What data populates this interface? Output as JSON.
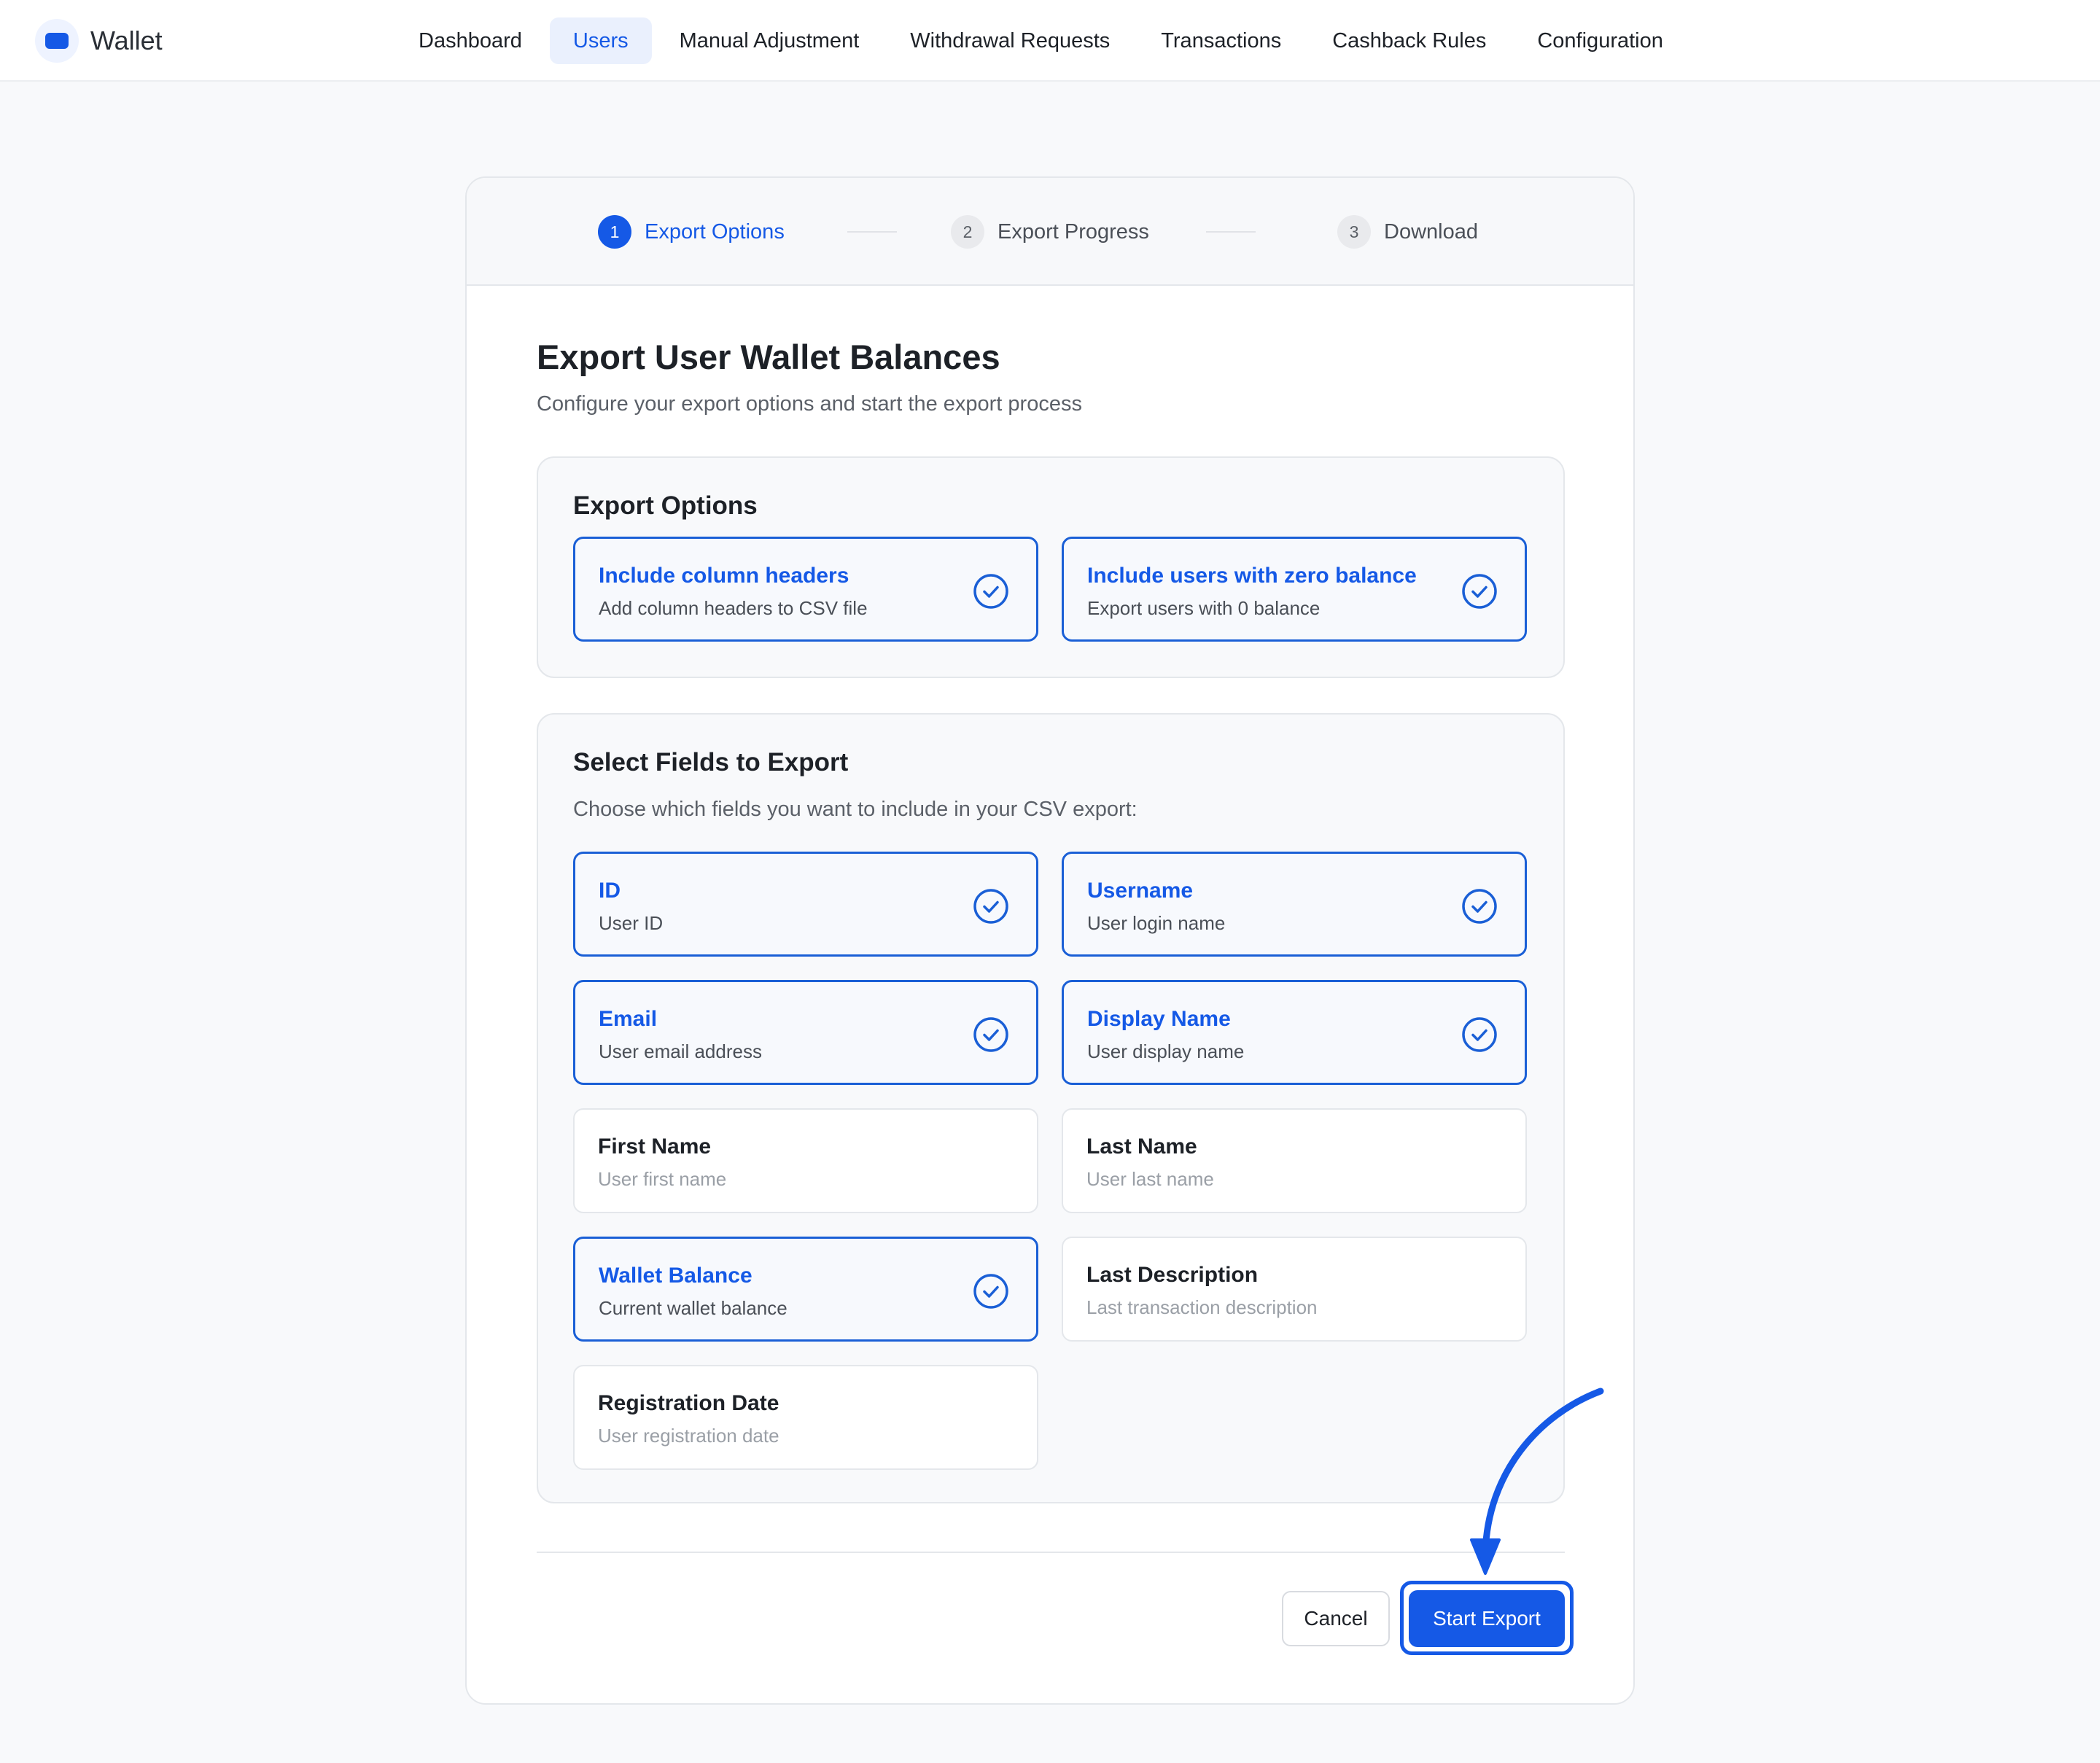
{
  "app": {
    "name": "Wallet",
    "logo_icon": "wallet-icon",
    "accent": "#1559e6"
  },
  "nav": [
    {
      "label": "Dashboard",
      "active": false
    },
    {
      "label": "Users",
      "active": true
    },
    {
      "label": "Manual Adjustment",
      "active": false
    },
    {
      "label": "Withdrawal Requests",
      "active": false
    },
    {
      "label": "Transactions",
      "active": false
    },
    {
      "label": "Cashback Rules",
      "active": false
    },
    {
      "label": "Configuration",
      "active": false
    }
  ],
  "stepper": [
    {
      "number": "1",
      "label": "Export Options",
      "active": true
    },
    {
      "number": "2",
      "label": "Export Progress",
      "active": false
    },
    {
      "number": "3",
      "label": "Download",
      "active": false
    }
  ],
  "page": {
    "title": "Export User Wallet Balances",
    "subtitle": "Configure your export options and start the export process"
  },
  "export_options": {
    "title": "Export Options",
    "items": [
      {
        "label": "Include column headers",
        "description": "Add column headers to CSV file",
        "selected": true
      },
      {
        "label": "Include users with zero balance",
        "description": "Export users with 0 balance",
        "selected": true
      }
    ]
  },
  "fields": {
    "title": "Select Fields to Export",
    "description": "Choose which fields you want to include in your CSV export:",
    "items": [
      {
        "label": "ID",
        "description": "User ID",
        "selected": true
      },
      {
        "label": "Username",
        "description": "User login name",
        "selected": true
      },
      {
        "label": "Email",
        "description": "User email address",
        "selected": true
      },
      {
        "label": "Display Name",
        "description": "User display name",
        "selected": true
      },
      {
        "label": "First Name",
        "description": "User first name",
        "selected": false
      },
      {
        "label": "Last Name",
        "description": "User last name",
        "selected": false
      },
      {
        "label": "Wallet Balance",
        "description": "Current wallet balance",
        "selected": true
      },
      {
        "label": "Last Description",
        "description": "Last transaction description",
        "selected": false
      },
      {
        "label": "Registration Date",
        "description": "User registration date",
        "selected": false
      }
    ]
  },
  "actions": {
    "cancel_label": "Cancel",
    "start_label": "Start Export"
  }
}
